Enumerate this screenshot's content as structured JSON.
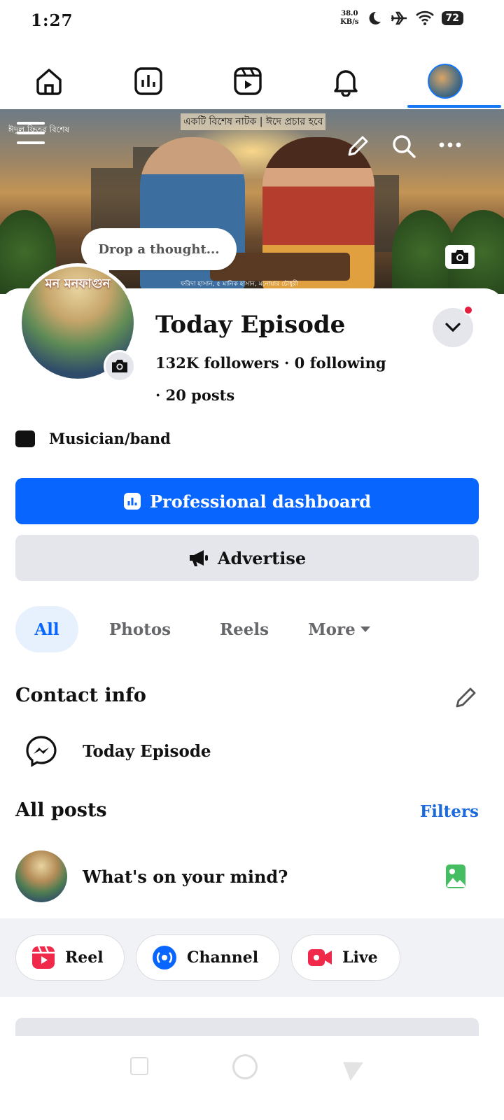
{
  "status_bar": {
    "time": "1:27",
    "net_speed_value": "38.0",
    "net_speed_unit": "KB/s",
    "battery": "72"
  },
  "nav": {
    "items": [
      "home-icon",
      "dashboard-icon",
      "video-icon",
      "bell-icon",
      "profile-avatar"
    ],
    "active": "profile-avatar",
    "accent": "#1877f2"
  },
  "cover": {
    "caption": "একটি বিশেষ নাটক | ঈদে প্রচার হবে",
    "credits": "ফরিদা হাসান, ৫ মানিক হাসান, মনোয়ার চৌধুরী",
    "side_text": "ঈদুল ফিতর বিশেষ",
    "poster_title": "মন মনফাগুন"
  },
  "thought_bubble": {
    "placeholder": "Drop a thought..."
  },
  "profile": {
    "name": "Today Episode",
    "stats_line1": "132K followers · 0 following",
    "stats_line2": "· 20 posts",
    "category": "Musician/band"
  },
  "buttons": {
    "professional_dashboard": "Professional dashboard",
    "advertise": "Advertise"
  },
  "tabs": [
    {
      "label": "All",
      "active": true
    },
    {
      "label": "Photos",
      "active": false
    },
    {
      "label": "Reels",
      "active": false
    },
    {
      "label": "More",
      "active": false
    }
  ],
  "contact": {
    "title": "Contact info",
    "messenger_name": "Today Episode"
  },
  "posts": {
    "title": "All posts",
    "filters": "Filters",
    "composer_placeholder": "What's on your mind?"
  },
  "quick_actions": [
    {
      "label": "Reel",
      "icon": "reel-icon",
      "color": "#f02849"
    },
    {
      "label": "Channel",
      "icon": "channel-icon",
      "color": "#0866ff"
    },
    {
      "label": "Live",
      "icon": "live-icon",
      "color": "#f02849"
    }
  ],
  "colors": {
    "primary": "#0866ff",
    "secondary_bg": "#e4e6eb",
    "link": "#1a6ad9",
    "notification": "#e41e3f"
  }
}
